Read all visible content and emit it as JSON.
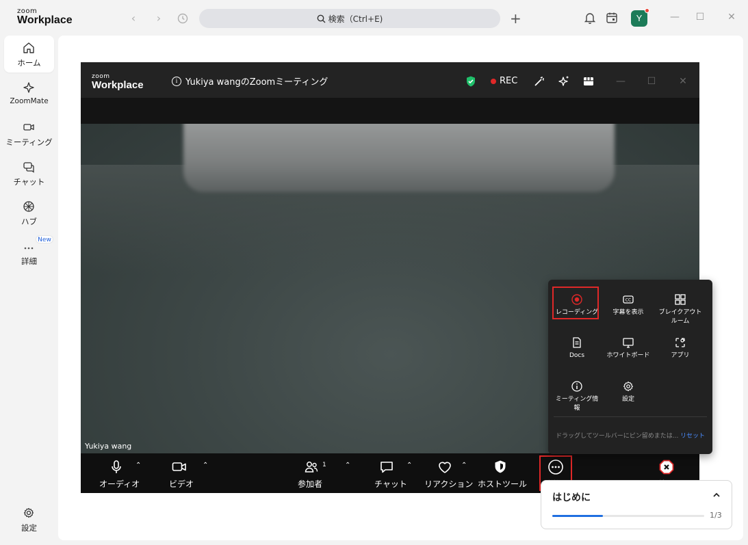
{
  "app": {
    "logo_small": "zoom",
    "logo_big": "Workplace"
  },
  "topbar": {
    "search_label": "検索（Ctrl+E)",
    "avatar_initial": "Y",
    "icons": [
      "back-icon",
      "forward-icon",
      "history-icon",
      "search-icon",
      "plus-icon",
      "bell-icon",
      "calendar-icon",
      "minimize-icon",
      "maximize-icon",
      "close-icon"
    ]
  },
  "sidebar": {
    "items": [
      {
        "label": "ホーム",
        "icon": "home-icon",
        "active": true
      },
      {
        "label": "ZoomMate",
        "icon": "sparkle-icon"
      },
      {
        "label": "ミーティング",
        "icon": "video-icon"
      },
      {
        "label": "チャット",
        "icon": "chat-icon"
      },
      {
        "label": "ハブ",
        "icon": "hub-icon"
      },
      {
        "label": "詳細",
        "icon": "more-icon",
        "badge": "New"
      }
    ],
    "settings_label": "設定"
  },
  "meeting": {
    "logo_small": "zoom",
    "logo_big": "Workplace",
    "topic": "Yukiya wangのZoomミーティング",
    "rec_label": "REC",
    "participant_name": "Yukiya wang",
    "toolbar": {
      "audio": "オーディオ",
      "video": "ビデオ",
      "participants": "参加者",
      "participants_count": "1",
      "chat": "チャット",
      "reactions": "リアクション",
      "host_tools": "ホストツール",
      "more": "詳細",
      "end": "終了"
    },
    "more_menu": {
      "recording": "レコーディング",
      "captions": "字幕を表示",
      "breakout_1": "ブレイクアウト",
      "breakout_2": "ルーム",
      "docs": "Docs",
      "whiteboard": "ホワイトボード",
      "apps": "アプリ",
      "meeting_info_1": "ミーティング情",
      "meeting_info_2": "報",
      "settings": "設定",
      "hint": "ドラッグしてツールバーにピン留めまたは...",
      "reset": "リセット"
    }
  },
  "getting_started": {
    "title": "はじめに",
    "progress": "1/3",
    "progress_fraction": 0.333
  },
  "colors": {
    "accent": "#1f6fe0",
    "record_red": "#e02828",
    "shield_green": "#1fbf6a",
    "avatar_green": "#1c7b58"
  }
}
